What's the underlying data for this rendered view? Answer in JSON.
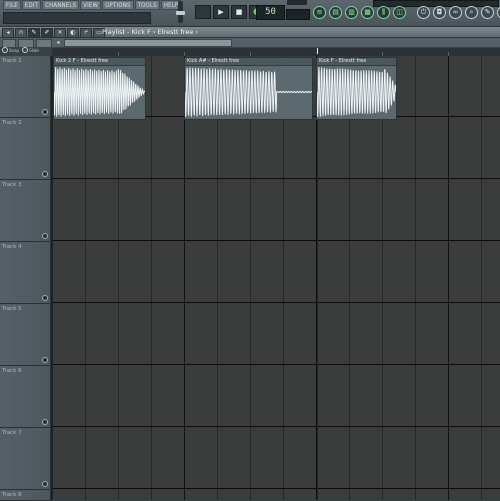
{
  "menu": [
    "FILE",
    "EDIT",
    "CHANNELS",
    "VIEW",
    "OPTIONS",
    "TOOLS",
    "HELP"
  ],
  "transport": {
    "play": "▶",
    "stop": "■",
    "record": "●",
    "tempo_display": "50"
  },
  "playlist": {
    "title": "Playlist - Kick F › Elrestt free ›",
    "radio_labels": [
      "Snap",
      "Slide"
    ]
  },
  "tracks": [
    "Track 1",
    "Track 2",
    "Track 3",
    "Track 4",
    "Track 5",
    "Track 6",
    "Track 7",
    "Track 8"
  ],
  "clips": [
    {
      "name": "Kick 2 F - Elrestt free"
    },
    {
      "name": "Kick A# - Elrestt free"
    },
    {
      "name": "Kick F - Elrestt free"
    }
  ],
  "colors": {
    "clip_bg": "#5c6a70",
    "wave": "#eef3f5",
    "grid": "#3b3d3d",
    "accent_green": "#7fd89b"
  }
}
